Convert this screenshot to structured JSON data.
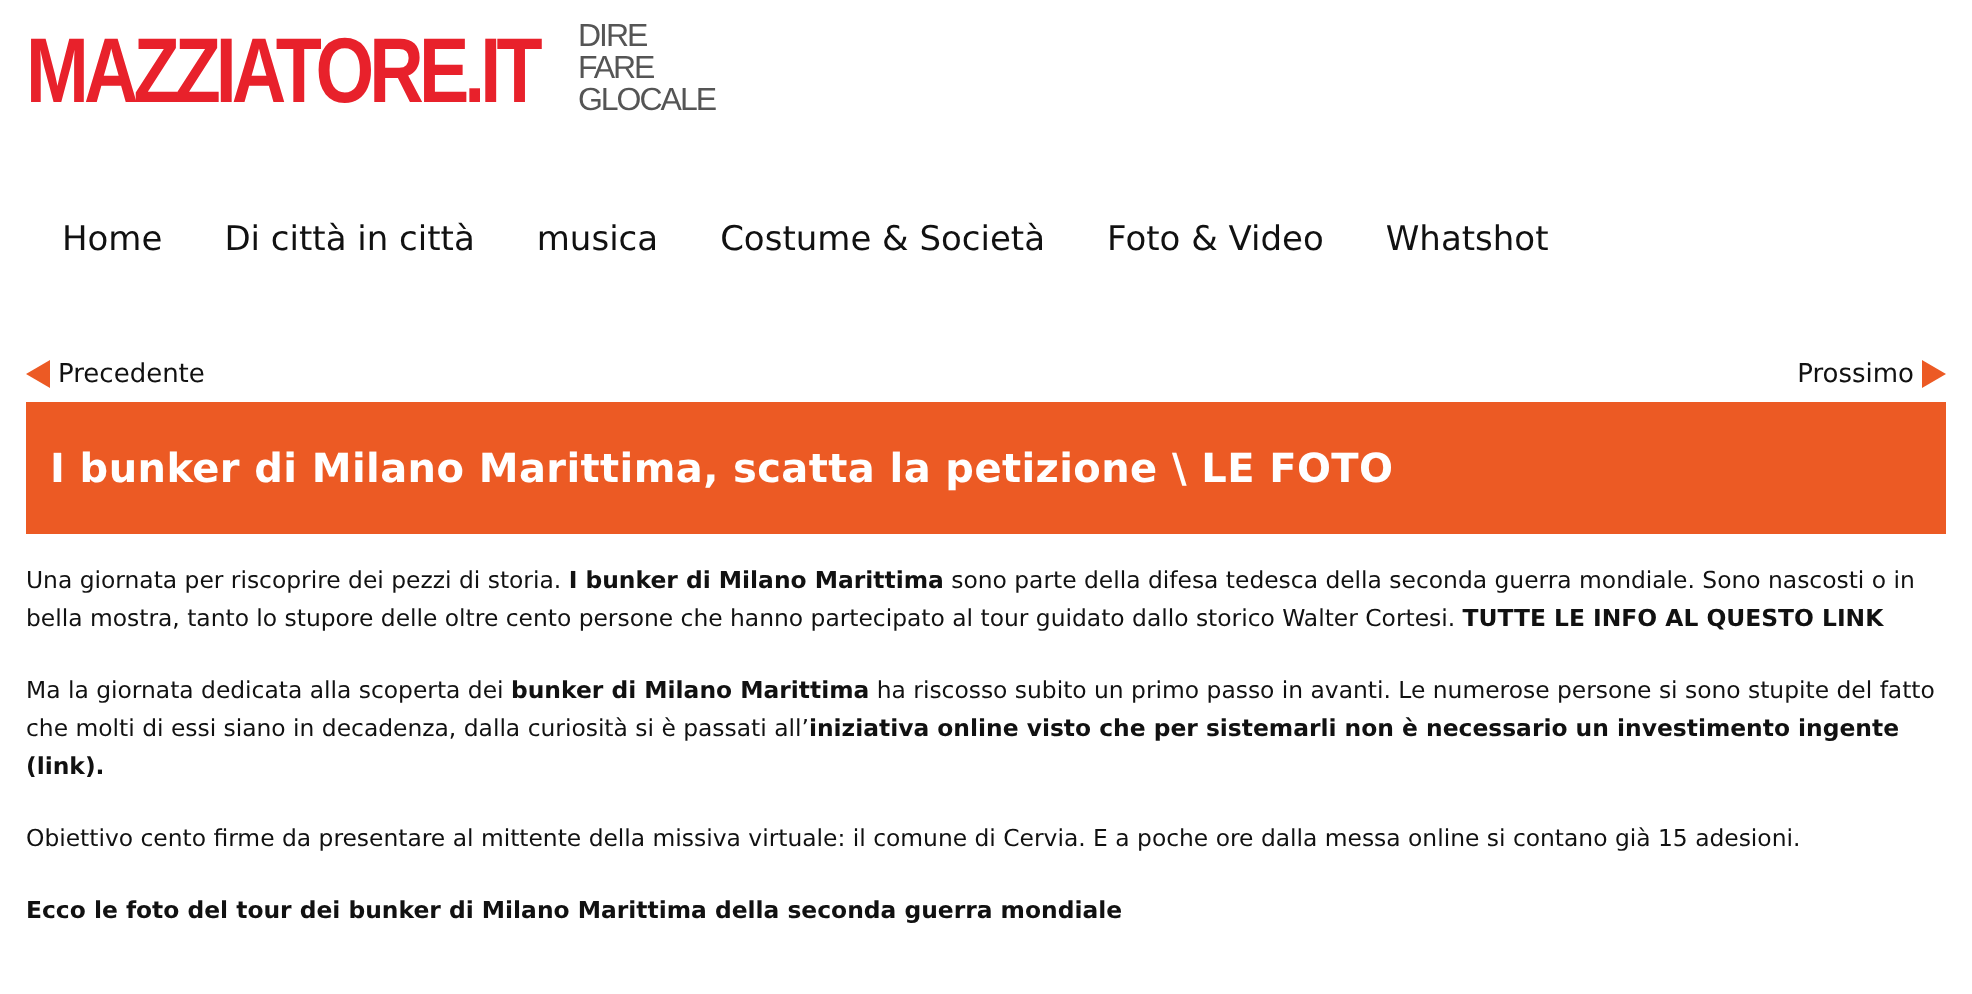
{
  "logo": {
    "name": "MAZZIATORE.IT",
    "tagline": [
      "DIRE",
      "FARE",
      "GLOCALE"
    ]
  },
  "nav": [
    "Home",
    "Di città in città",
    "musica",
    "Costume & Società",
    "Foto & Video",
    "Whatshot"
  ],
  "pager": {
    "previous": "Precedente",
    "next": "Prossimo"
  },
  "article": {
    "title": "I bunker di Milano Marittima, scatta la petizione \\ LE FOTO",
    "paragraphs": [
      {
        "text": "Una giornata per riscoprire dei pezzi di storia. **I bunker di Milano Marittima** sono parte della difesa tedesca della seconda guerra mondiale. Sono nascosti o in bella mostra, tanto lo stupore delle oltre cento persone che hanno partecipato al tour guidato dallo storico Walter Cortesi. **TUTTE LE INFO AL QUESTO LINK**",
        "bold": false
      },
      {
        "text": "Ma la giornata dedicata alla scoperta dei **bunker di Milano Marittima** ha riscosso subito un primo passo in avanti. Le numerose persone si sono stupite del fatto che molti di essi siano in decadenza, dalla curiosità si è passati all’**iniziativa online visto che per sistemarli non è necessario un investimento ingente (link).**",
        "bold": false
      },
      {
        "text": "Obiettivo cento firme da presentare al mittente della missiva virtuale: il comune di Cervia. E a poche ore dalla messa online si contano già 15 adesioni.",
        "bold": false
      },
      {
        "text": "Ecco le foto del tour dei bunker di Milano Marittima della seconda guerra mondiale",
        "bold": true
      }
    ]
  }
}
